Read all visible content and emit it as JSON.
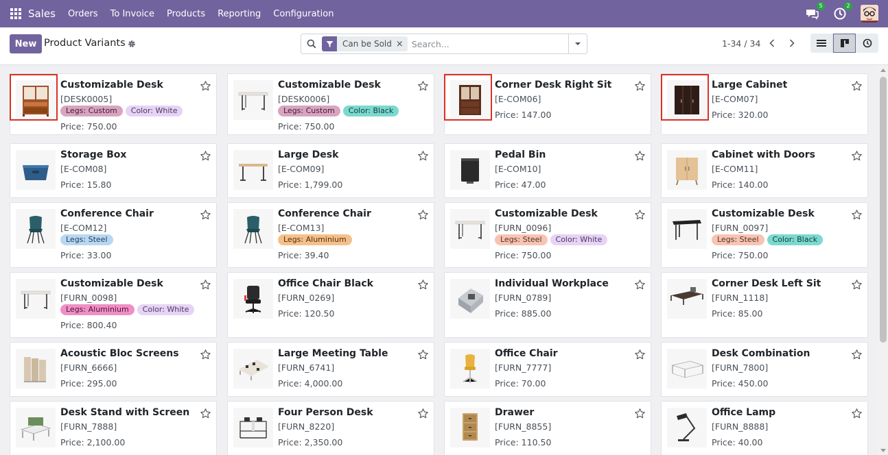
{
  "topbar": {
    "app_name": "Sales",
    "menu": [
      "Orders",
      "To Invoice",
      "Products",
      "Reporting",
      "Configuration"
    ],
    "messages_count": "5",
    "activities_count": "2"
  },
  "control_panel": {
    "new_label": "New",
    "title": "Product Variants",
    "facet_label": "Can be Sold",
    "search_placeholder": "Search...",
    "pager": "1-34 / 34"
  },
  "cards": [
    {
      "name": "Customizable Desk",
      "code": "[DESK0005]",
      "tags": [
        {
          "label": "Legs: Custom",
          "kind": "pink"
        },
        {
          "label": "Color: White",
          "kind": "lavender"
        }
      ],
      "price": "Price: 750.00",
      "image": "hutch",
      "highlighted": true
    },
    {
      "name": "Customizable Desk",
      "code": "[DESK0006]",
      "tags": [
        {
          "label": "Legs: Custom",
          "kind": "pink"
        },
        {
          "label": "Color: Black",
          "kind": "teal"
        }
      ],
      "price": "Price: 750.00",
      "image": "desk-white",
      "highlighted": false
    },
    {
      "name": "Corner Desk Right Sit",
      "code": "[E-COM06]",
      "tags": [],
      "price": "Price: 147.00",
      "image": "hutch-dark",
      "highlighted": true
    },
    {
      "name": "Large Cabinet",
      "code": "[E-COM07]",
      "tags": [],
      "price": "Price: 320.00",
      "image": "cabinet-dark",
      "highlighted": true
    },
    {
      "name": "Storage Box",
      "code": "[E-COM08]",
      "tags": [],
      "price": "Price: 15.80",
      "image": "box",
      "highlighted": false
    },
    {
      "name": "Large Desk",
      "code": "[E-COM09]",
      "tags": [],
      "price": "Price: 1,799.00",
      "image": "desk-wood",
      "highlighted": false
    },
    {
      "name": "Pedal Bin",
      "code": "[E-COM10]",
      "tags": [],
      "price": "Price: 47.00",
      "image": "bin",
      "highlighted": false
    },
    {
      "name": "Cabinet with Doors",
      "code": "[E-COM11]",
      "tags": [],
      "price": "Price: 140.00",
      "image": "cabinet-wood",
      "highlighted": false
    },
    {
      "name": "Conference Chair",
      "code": "[E-COM12]",
      "tags": [
        {
          "label": "Legs: Steel",
          "kind": "blue"
        }
      ],
      "price": "Price: 33.00",
      "image": "chair-teal",
      "highlighted": false
    },
    {
      "name": "Conference Chair",
      "code": "[E-COM13]",
      "tags": [
        {
          "label": "Legs: Aluminium",
          "kind": "orange"
        }
      ],
      "price": "Price: 39.40",
      "image": "chair-teal",
      "highlighted": false
    },
    {
      "name": "Customizable Desk",
      "code": "[FURN_0096]",
      "tags": [
        {
          "label": "Legs: Steel",
          "kind": "salmon"
        },
        {
          "label": "Color: White",
          "kind": "lavender"
        }
      ],
      "price": "Price: 750.00",
      "image": "desk-white",
      "highlighted": false
    },
    {
      "name": "Customizable Desk",
      "code": "[FURN_0097]",
      "tags": [
        {
          "label": "Legs: Steel",
          "kind": "salmon"
        },
        {
          "label": "Color: Black",
          "kind": "teal"
        }
      ],
      "price": "Price: 750.00",
      "image": "desk-black",
      "highlighted": false
    },
    {
      "name": "Customizable Desk",
      "code": "[FURN_0098]",
      "tags": [
        {
          "label": "Legs: Aluminium",
          "kind": "magenta"
        },
        {
          "label": "Color: White",
          "kind": "lavender"
        }
      ],
      "price": "Price: 800.40",
      "image": "desk-white",
      "highlighted": false
    },
    {
      "name": "Office Chair Black",
      "code": "[FURN_0269]",
      "tags": [],
      "price": "Price: 120.50",
      "image": "chair-office-black",
      "highlighted": false
    },
    {
      "name": "Individual Workplace",
      "code": "[FURN_0789]",
      "tags": [],
      "price": "Price: 885.00",
      "image": "workplace",
      "highlighted": false
    },
    {
      "name": "Corner Desk Left Sit",
      "code": "[FURN_1118]",
      "tags": [],
      "price": "Price: 85.00",
      "image": "corner-desk",
      "highlighted": false
    },
    {
      "name": "Acoustic Bloc Screens",
      "code": "[FURN_6666]",
      "tags": [],
      "price": "Price: 295.00",
      "image": "screens",
      "highlighted": false
    },
    {
      "name": "Large Meeting Table",
      "code": "[FURN_6741]",
      "tags": [],
      "price": "Price: 4,000.00",
      "image": "meeting-table",
      "highlighted": false
    },
    {
      "name": "Office Chair",
      "code": "[FURN_7777]",
      "tags": [],
      "price": "Price: 70.00",
      "image": "chair-yellow",
      "highlighted": false
    },
    {
      "name": "Desk Combination",
      "code": "[FURN_7800]",
      "tags": [],
      "price": "Price: 450.00",
      "image": "desk-combo",
      "highlighted": false
    },
    {
      "name": "Desk Stand with Screen",
      "code": "[FURN_7888]",
      "tags": [],
      "price": "Price: 2,100.00",
      "image": "desk-screen",
      "highlighted": false
    },
    {
      "name": "Four Person Desk",
      "code": "[FURN_8220]",
      "tags": [],
      "price": "Price: 2,350.00",
      "image": "four-desk",
      "highlighted": false
    },
    {
      "name": "Drawer",
      "code": "[FURN_8855]",
      "tags": [],
      "price": "Price: 110.50",
      "image": "drawer",
      "highlighted": false
    },
    {
      "name": "Office Lamp",
      "code": "[FURN_8888]",
      "tags": [],
      "price": "Price: 40.00",
      "image": "lamp",
      "highlighted": false
    }
  ],
  "colors": {
    "brand": "#71639e",
    "tag_pink": "#d9a4c0",
    "tag_lavender": "#e6d3f5",
    "tag_teal": "#7bd9cf",
    "tag_blue": "#b8d7f2",
    "tag_orange": "#f6c08a",
    "tag_salmon": "#f7c4b4",
    "tag_magenta": "#ef8fc6"
  }
}
